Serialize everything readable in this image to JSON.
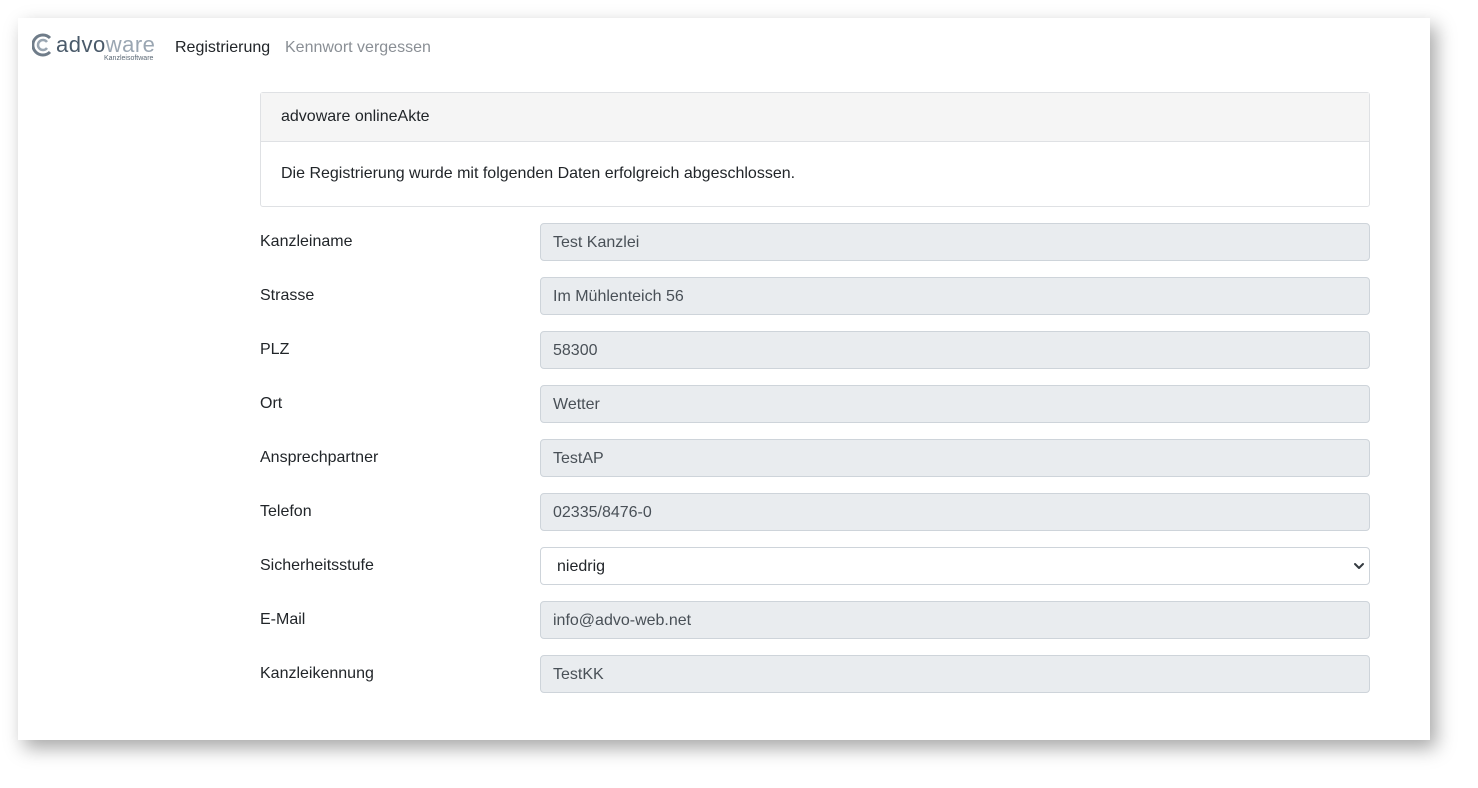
{
  "nav": {
    "logo_text_a": "advo",
    "logo_text_b": "ware",
    "logo_sub": "Kanzleisoftware",
    "register_label": "Registrierung",
    "forgot_label": "Kennwort vergessen"
  },
  "card": {
    "header": "advoware onlineAkte",
    "message": "Die Registrierung wurde mit folgenden Daten erfolgreich abgeschlossen."
  },
  "form": {
    "fields": [
      {
        "label": "Kanzleiname",
        "value": "Test Kanzlei"
      },
      {
        "label": "Strasse",
        "value": "Im Mühlenteich 56"
      },
      {
        "label": "PLZ",
        "value": "58300"
      },
      {
        "label": "Ort",
        "value": "Wetter"
      },
      {
        "label": "Ansprechpartner",
        "value": "TestAP"
      },
      {
        "label": "Telefon",
        "value": "02335/8476-0"
      },
      {
        "label": "Sicherheitsstufe",
        "value": "niedrig"
      },
      {
        "label": "E-Mail",
        "value": "info@advo-web.net"
      },
      {
        "label": "Kanzleikennung",
        "value": "TestKK"
      }
    ]
  },
  "colors": {
    "readonly_bg": "#e9ecef",
    "card_header_bg": "#f5f5f5",
    "muted_link": "#8a8f95"
  }
}
